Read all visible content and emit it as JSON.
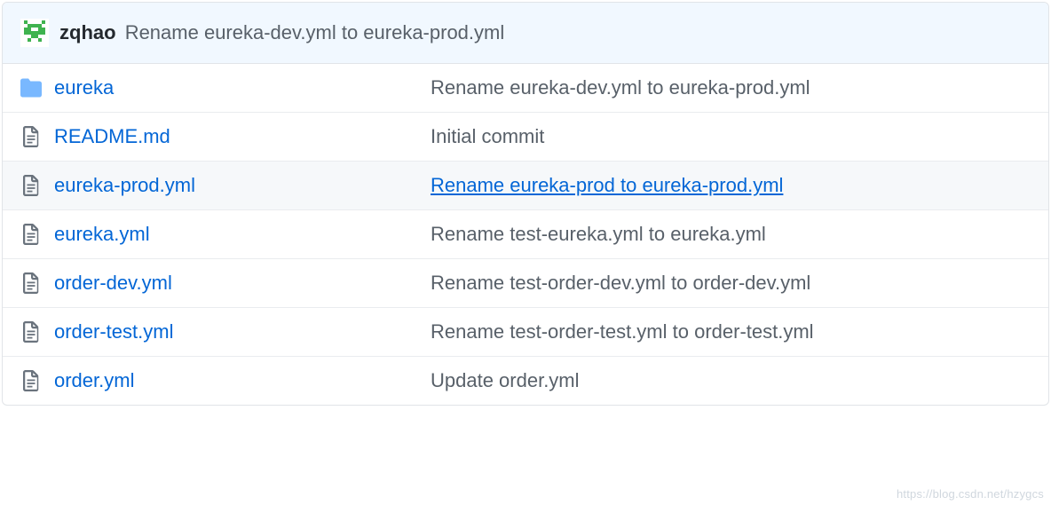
{
  "header": {
    "author": "zqhao",
    "message": "Rename eureka-dev.yml to eureka-prod.yml"
  },
  "files": [
    {
      "type": "folder",
      "name": "eureka",
      "commit": "Rename eureka-dev.yml to eureka-prod.yml",
      "active": false,
      "hovered": false
    },
    {
      "type": "file",
      "name": "README.md",
      "commit": "Initial commit",
      "active": false,
      "hovered": false
    },
    {
      "type": "file",
      "name": "eureka-prod.yml",
      "commit": "Rename eureka-prod to eureka-prod.yml",
      "active": true,
      "hovered": true
    },
    {
      "type": "file",
      "name": "eureka.yml",
      "commit": "Rename test-eureka.yml to eureka.yml",
      "active": false,
      "hovered": false
    },
    {
      "type": "file",
      "name": "order-dev.yml",
      "commit": "Rename test-order-dev.yml to order-dev.yml",
      "active": false,
      "hovered": false
    },
    {
      "type": "file",
      "name": "order-test.yml",
      "commit": "Rename test-order-test.yml to order-test.yml",
      "active": false,
      "hovered": false
    },
    {
      "type": "file",
      "name": "order.yml",
      "commit": "Update order.yml",
      "active": false,
      "hovered": false
    }
  ],
  "watermark": "https://blog.csdn.net/hzygcs"
}
